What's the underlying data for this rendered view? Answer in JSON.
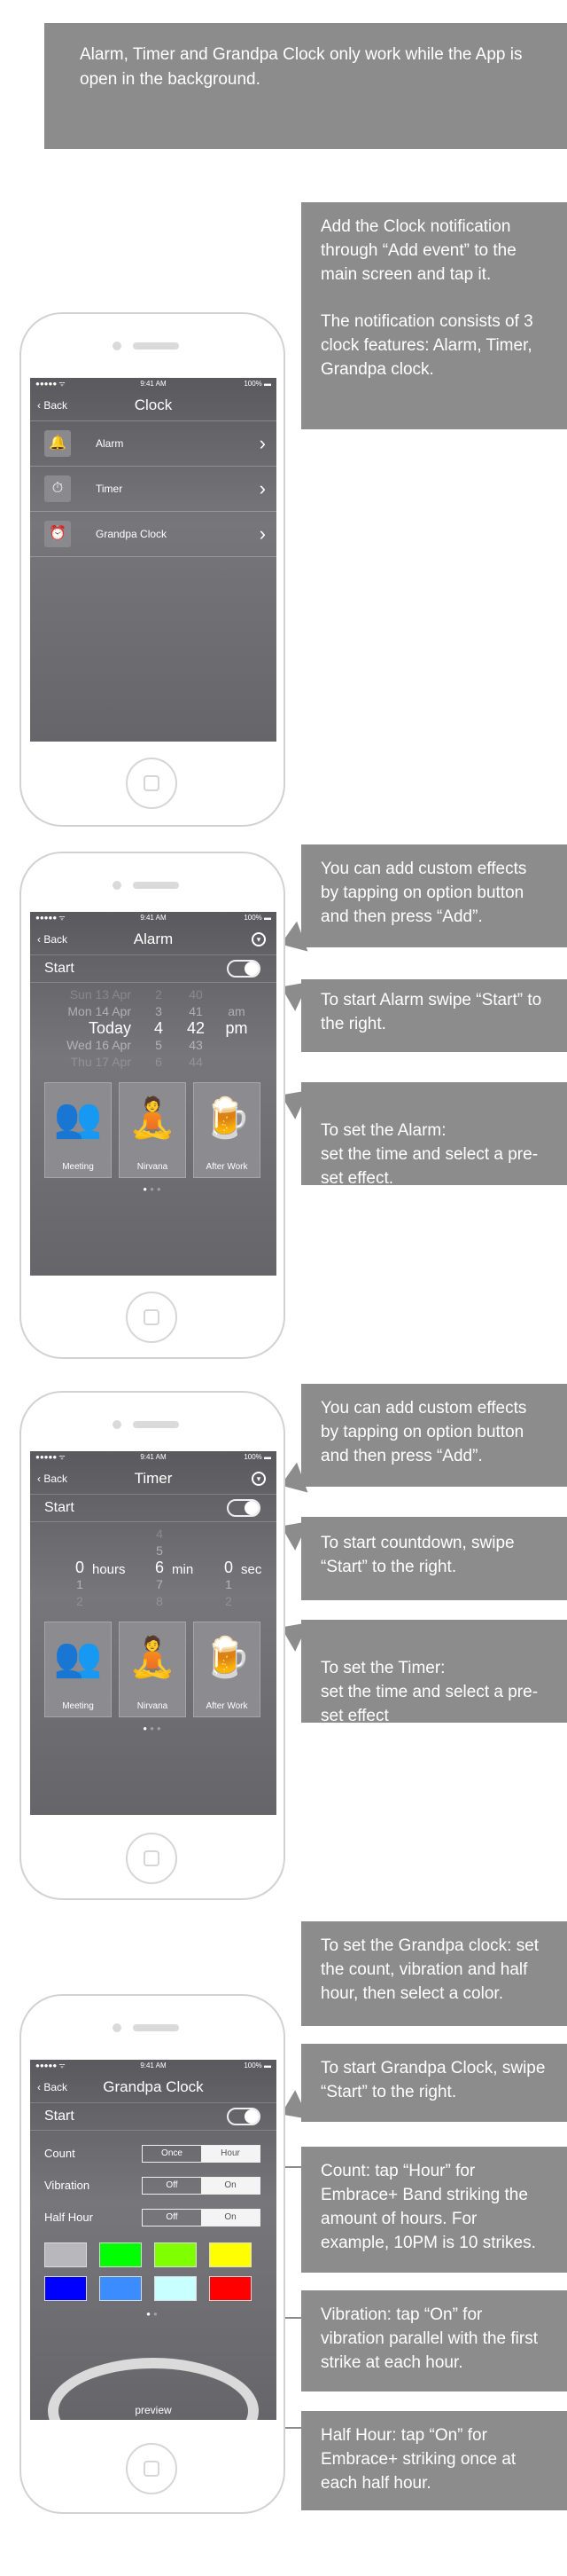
{
  "top_note": "Alarm, Timer and Grandpa Clock only work while the App is open in the background.",
  "status_bar": {
    "signal": "●●●●● ᯤ",
    "time": "9:41 AM",
    "battery": "100% ▬"
  },
  "clock_section": {
    "callout_1": "Add the Clock notification through “Add event”  to the main screen and tap it.",
    "callout_2": "The notification consists of 3 clock features: Alarm, Timer, Grandpa clock.",
    "screen": {
      "back": "Back",
      "title": "Clock",
      "items": [
        {
          "label": "Alarm",
          "icon": "bell-icon"
        },
        {
          "label": "Timer",
          "icon": "stopwatch-icon"
        },
        {
          "label": "Grandpa Clock",
          "icon": "alarm-clock-icon"
        }
      ]
    }
  },
  "alarm_section": {
    "callout_options": "You can add custom effects by tapping on option button and then press “Add”.",
    "callout_start": "To start Alarm swipe “Start” to the right.",
    "callout_set": "To set the Alarm:\nset the time and select a pre-set effect.",
    "screen": {
      "back": "Back",
      "title": "Alarm",
      "start_label": "Start",
      "picker": {
        "days": [
          "Sun 13 Apr",
          "Mon 14 Apr",
          "Today",
          "Wed 16 Apr",
          "Thu 17 Apr"
        ],
        "hours": [
          "2",
          "3",
          "4",
          "5",
          "6"
        ],
        "minutes": [
          "40",
          "41",
          "42",
          "43",
          "44"
        ],
        "ampm": [
          "am",
          "pm"
        ]
      },
      "effects": [
        "Meeting",
        "Nirvana",
        "After Work"
      ]
    }
  },
  "timer_section": {
    "callout_options": "You can add custom effects by tapping on option button and then press “Add”.",
    "callout_start": "To start countdown, swipe “Start”  to the right.",
    "callout_set": "To set the Timer:\nset the time and select a pre-set effect",
    "screen": {
      "back": "Back",
      "title": "Timer",
      "start_label": "Start",
      "picker": {
        "hours_values": [
          "0",
          "1",
          "2"
        ],
        "hours_unit": "hours",
        "min_above": [
          "4",
          "5"
        ],
        "min_values": [
          "6",
          "7",
          "8"
        ],
        "min_unit": "min",
        "sec_values": [
          "0",
          "1",
          "2"
        ],
        "sec_unit": "sec"
      },
      "effects": [
        "Meeting",
        "Nirvana",
        "After Work"
      ]
    }
  },
  "grandpa_section": {
    "callout_set": "To set the Grandpa clock: set the count, vibration and half hour, then select a color.",
    "callout_start": "To start Grandpa Clock, swipe “Start” to the right.",
    "callout_count": "Count: tap “Hour” for Embrace+ Band striking the amount of hours. For example, 10PM is 10 strikes.",
    "callout_vibration": "Vibration: tap “On” for vibration parallel with the first strike at each hour.",
    "callout_half": "Half Hour: tap “On” for Embrace+ striking once at each half hour.",
    "screen": {
      "back": "Back",
      "title": "Grandpa Clock",
      "start_label": "Start",
      "rows": [
        {
          "label": "Count",
          "options": [
            "Once",
            "Hour"
          ],
          "selected": 1
        },
        {
          "label": "Vibration",
          "options": [
            "Off",
            "On"
          ],
          "selected": 1
        },
        {
          "label": "Half Hour",
          "options": [
            "Off",
            "On"
          ],
          "selected": 1
        }
      ],
      "colors": [
        "#b8b8bc",
        "#00ff00",
        "#80ff00",
        "#ffff00",
        "#0000ff",
        "#3a8cff",
        "#c8ffff",
        "#ff0000"
      ],
      "preview": "preview"
    }
  }
}
